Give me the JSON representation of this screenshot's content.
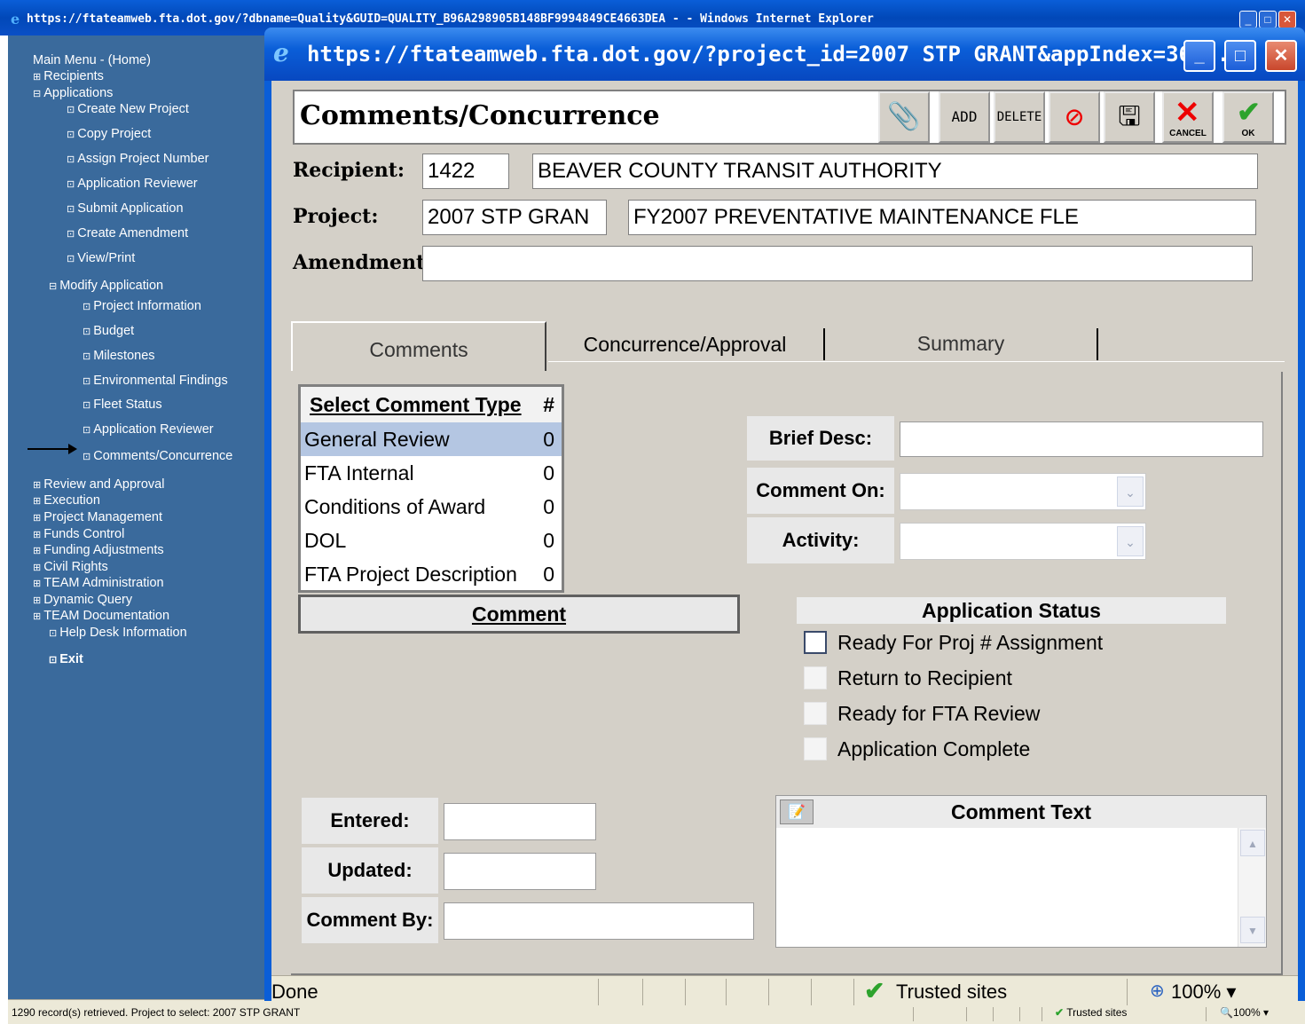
{
  "outer_window": {
    "title": "https://ftateamweb.fta.dot.gov/?dbname=Quality&GUID=QUALITY_B96A298905B148BF9994849CE4663DEA - - Windows Internet Explorer",
    "status_text": "1290 record(s) retrieved. Project to select: 2007 STP GRANT",
    "zone": "Trusted sites",
    "zoom": "100%"
  },
  "nav": {
    "items": [
      {
        "label": "Main Menu - (Home)",
        "prefix": ""
      },
      {
        "label": "Recipients",
        "prefix": "⊞"
      },
      {
        "label": "Applications",
        "prefix": "⊟"
      },
      {
        "label": "Create New Project",
        "prefix": "⊡"
      },
      {
        "label": "Copy Project",
        "prefix": "⊡"
      },
      {
        "label": "Assign Project Number",
        "prefix": "⊡"
      },
      {
        "label": "Application Reviewer",
        "prefix": "⊡"
      },
      {
        "label": "Submit Application",
        "prefix": "⊡"
      },
      {
        "label": "Create Amendment",
        "prefix": "⊡"
      },
      {
        "label": "View/Print",
        "prefix": "⊡"
      },
      {
        "label": "Modify Application",
        "prefix": "⊟"
      },
      {
        "label": "Project Information",
        "prefix": "⊡"
      },
      {
        "label": "Budget",
        "prefix": "⊡"
      },
      {
        "label": "Milestones",
        "prefix": "⊡"
      },
      {
        "label": "Environmental Findings",
        "prefix": "⊡"
      },
      {
        "label": "Fleet Status",
        "prefix": "⊡"
      },
      {
        "label": "Application Reviewer",
        "prefix": "⊡"
      },
      {
        "label": "Comments/Concurrence",
        "prefix": "⊡"
      },
      {
        "label": "Review and Approval",
        "prefix": "⊞"
      },
      {
        "label": "Execution",
        "prefix": "⊞"
      },
      {
        "label": "Project Management",
        "prefix": "⊞"
      },
      {
        "label": "Funds Control",
        "prefix": "⊞"
      },
      {
        "label": "Funding Adjustments",
        "prefix": "⊞"
      },
      {
        "label": "Civil Rights",
        "prefix": "⊞"
      },
      {
        "label": "TEAM Administration",
        "prefix": "⊞"
      },
      {
        "label": "Dynamic Query",
        "prefix": "⊞"
      },
      {
        "label": "TEAM Documentation",
        "prefix": "⊞"
      },
      {
        "label": "Help Desk Information",
        "prefix": "⊡"
      },
      {
        "label": "Exit",
        "prefix": "⊡"
      }
    ]
  },
  "popup": {
    "title": "https://ftateamweb.fta.dot.gov/?project_id=2007 STP GRANT&appIndex=36...",
    "heading": "Comments/Concurrence",
    "toolbar": {
      "attach_icon": "paperclip-icon",
      "add_label": "ADD",
      "delete_label": "DELETE",
      "no_save_icon": "no-save-icon",
      "save_icon": "floppy-disk-icon",
      "cancel_label": "CANCEL",
      "ok_label": "OK"
    },
    "recipient_label": "Recipient:",
    "recipient_id": "1422",
    "recipient_name": "BEAVER COUNTY TRANSIT AUTHORITY",
    "project_label": "Project:",
    "project_id": "2007 STP GRAN",
    "project_name": "FY2007 PREVENTATIVE MAINTENANCE FLE",
    "amendment_label": "Amendment:",
    "amendment_value": "",
    "tabs": [
      "Comments",
      "Concurrence/Approval",
      "Summary"
    ],
    "comment_types": {
      "header": "Select Comment Type",
      "count_header": "#",
      "rows": [
        {
          "name": "General Review",
          "count": "0"
        },
        {
          "name": "FTA Internal",
          "count": "0"
        },
        {
          "name": "Conditions of Award",
          "count": "0"
        },
        {
          "name": "DOL",
          "count": "0"
        },
        {
          "name": "FTA Project Description",
          "count": "0"
        }
      ]
    },
    "comment_button": "Comment",
    "brief_desc_label": "Brief Desc:",
    "comment_on_label": "Comment On:",
    "activity_label": "Activity:",
    "app_status": {
      "header": "Application Status",
      "options": [
        "Ready For Proj # Assignment",
        "Return to Recipient",
        "Ready for FTA Review",
        "Application Complete"
      ]
    },
    "entered_label": "Entered:",
    "updated_label": "Updated:",
    "comment_by_label": "Comment By:",
    "comment_text_header": "Comment Text",
    "status_done": "Done",
    "zone": "Trusted sites",
    "zoom": "100%"
  }
}
